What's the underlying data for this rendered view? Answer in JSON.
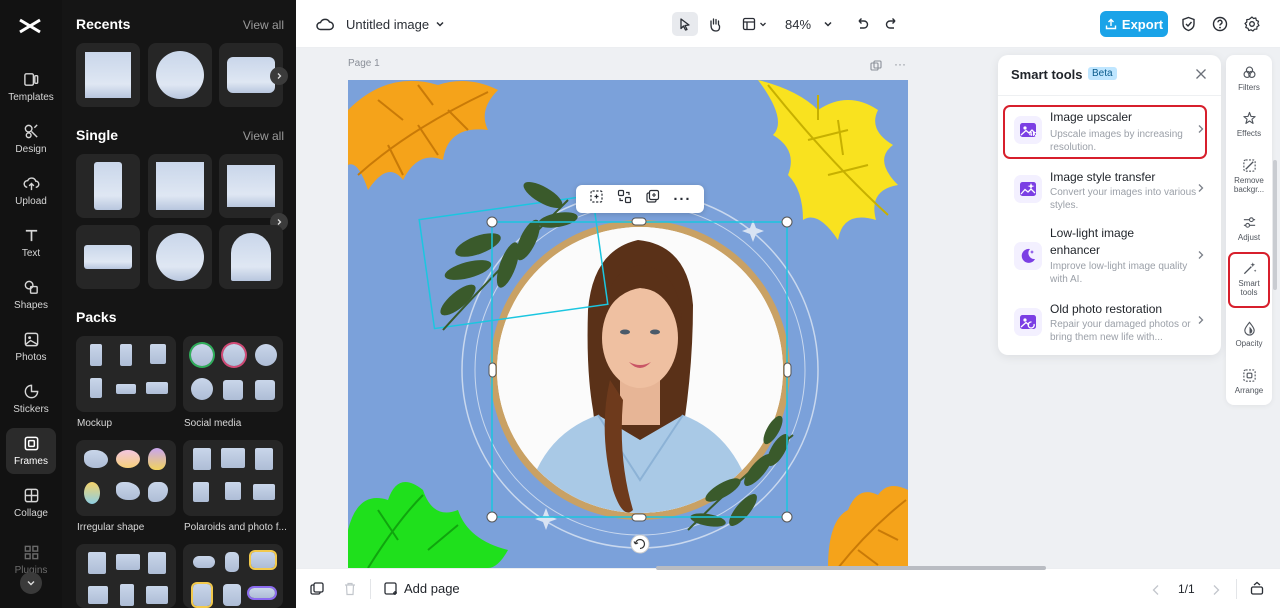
{
  "rail": {
    "items": [
      {
        "label": "Templates",
        "icon": "templates-icon"
      },
      {
        "label": "Design",
        "icon": "design-icon"
      },
      {
        "label": "Upload",
        "icon": "upload-icon"
      },
      {
        "label": "Text",
        "icon": "text-icon"
      },
      {
        "label": "Shapes",
        "icon": "shapes-icon"
      },
      {
        "label": "Photos",
        "icon": "photos-icon"
      },
      {
        "label": "Stickers",
        "icon": "stickers-icon"
      },
      {
        "label": "Frames",
        "icon": "frames-icon"
      },
      {
        "label": "Collage",
        "icon": "collage-icon"
      },
      {
        "label": "Plugins",
        "icon": "plugins-icon"
      }
    ],
    "active": "Frames"
  },
  "panel": {
    "recents_title": "Recents",
    "recents_view_all": "View all",
    "single_title": "Single",
    "single_view_all": "View all",
    "packs_title": "Packs",
    "packs": [
      {
        "label": "Mockup"
      },
      {
        "label": "Social media"
      },
      {
        "label": "Irregular shape"
      },
      {
        "label": "Polaroids and photo f..."
      }
    ]
  },
  "topbar": {
    "title": "Untitled image",
    "zoom": "84%",
    "export_label": "Export"
  },
  "canvas": {
    "page_label": "Page 1"
  },
  "smart_tools": {
    "title": "Smart tools",
    "badge": "Beta",
    "tools": [
      {
        "name": "Image upscaler",
        "desc": "Upscale images by increasing resolution."
      },
      {
        "name": "Image style transfer",
        "desc": "Convert your images into various styles."
      },
      {
        "name": "Low-light image enhancer",
        "desc": "Improve low-light image quality with AI."
      },
      {
        "name": "Old photo restoration",
        "desc": "Repair your damaged photos or bring them new life with..."
      }
    ]
  },
  "right_rail": {
    "items": [
      {
        "label": "Filters"
      },
      {
        "label": "Effects"
      },
      {
        "label": "Remove backgr..."
      },
      {
        "label": "Adjust"
      },
      {
        "label": "Smart tools"
      },
      {
        "label": "Opacity"
      },
      {
        "label": "Arrange"
      }
    ]
  },
  "bottombar": {
    "add_page": "Add page",
    "pagination": "1/1"
  },
  "colors": {
    "accent": "#1aa3e8",
    "highlight": "#d71f2c",
    "artboard_bg": "#7ba1da"
  }
}
